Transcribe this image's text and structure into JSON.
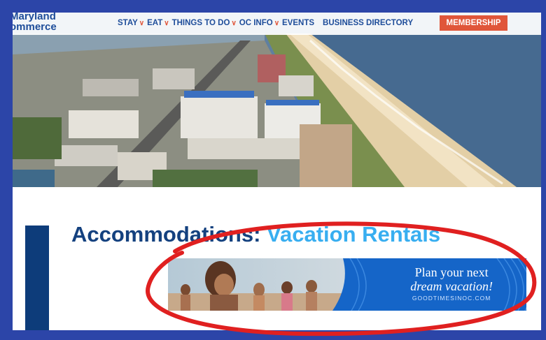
{
  "logo": {
    "line1": "Maryland",
    "line2": "ommerce"
  },
  "nav": {
    "items": [
      {
        "label": "STAY",
        "dropdown": true
      },
      {
        "label": "EAT",
        "dropdown": true
      },
      {
        "label": "THINGS TO DO",
        "dropdown": true
      },
      {
        "label": "OC INFO",
        "dropdown": true
      },
      {
        "label": "EVENTS",
        "dropdown": false
      },
      {
        "label": "BUSINESS DIRECTORY",
        "dropdown": false
      }
    ],
    "membership": "MEMBERSHIP"
  },
  "page": {
    "title_part1": "Accommodations: ",
    "title_part2": "Vacation Rentals"
  },
  "ad": {
    "line1": "Plan your next",
    "line2": "dream vacation!",
    "url": "GOODTIMESINOC.COM"
  },
  "colors": {
    "brand_blue": "#1e4d9a",
    "accent_orange": "#e0563a",
    "title_light": "#38aef0",
    "frame": "#2c45a8",
    "highlight_red": "#e02020"
  }
}
